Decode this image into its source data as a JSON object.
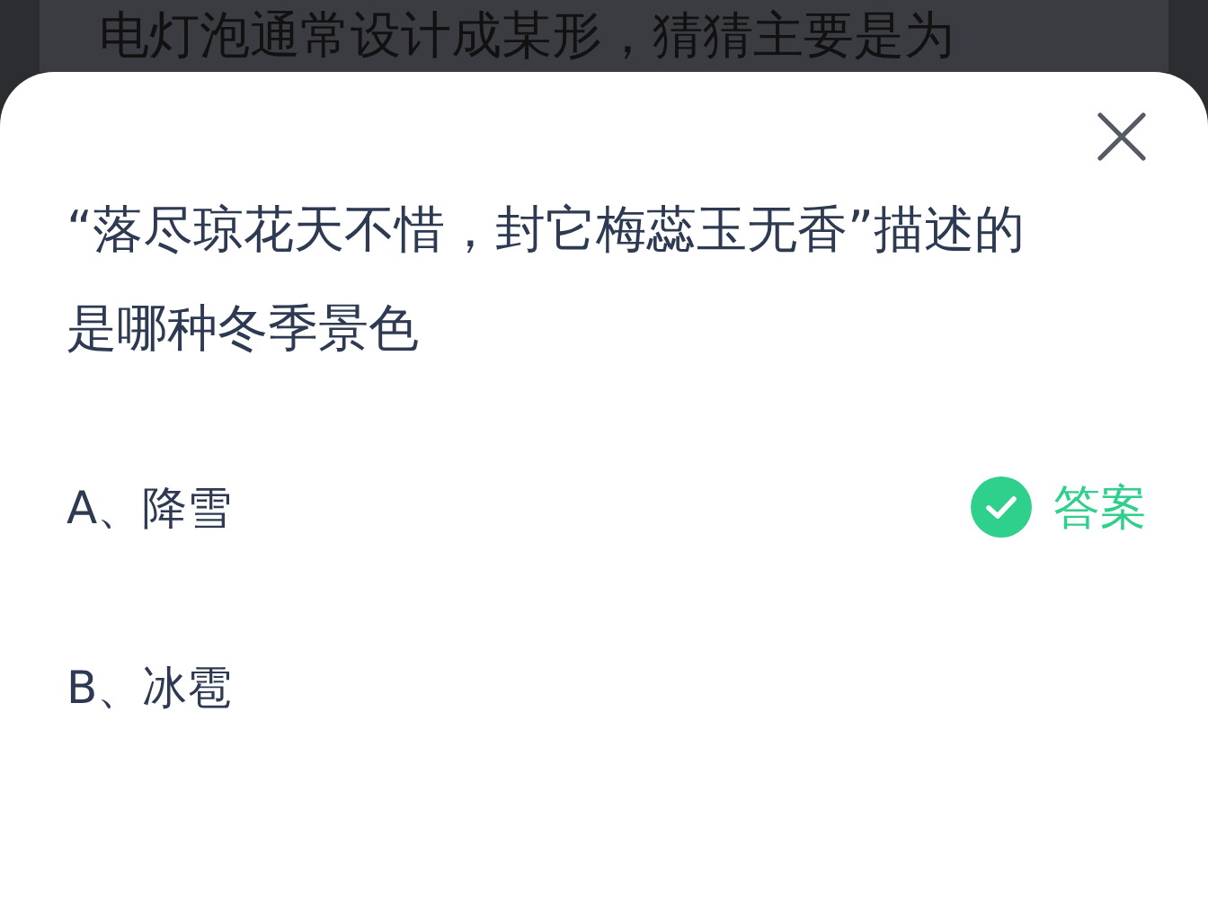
{
  "background_text": "电灯泡通常设计成某形，猜猜主要是为",
  "question": "“落尽琼花天不惜，封它梅蕊玉无香”描述的是哪种冬季景色",
  "options": [
    {
      "label": "A、降雪",
      "is_answer": true,
      "answer_label": "答案"
    },
    {
      "label": "B、冰雹",
      "is_answer": false
    }
  ]
}
